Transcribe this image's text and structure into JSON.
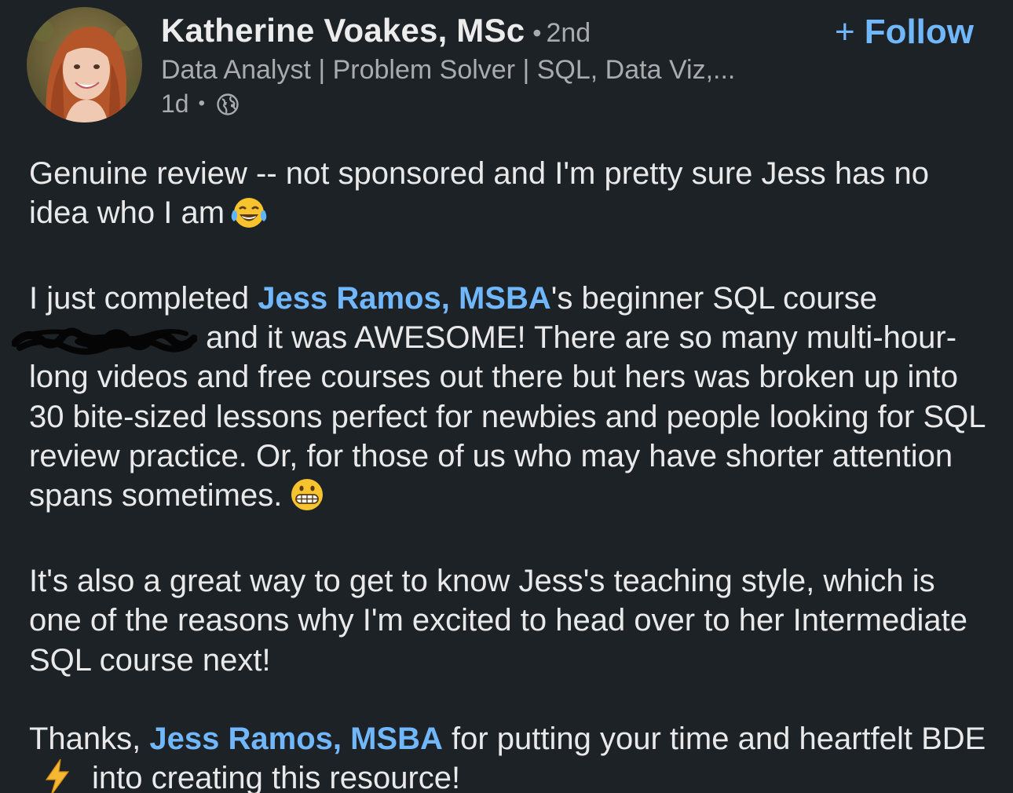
{
  "post": {
    "author": {
      "name": "Katherine Voakes, MSc",
      "degree_separator": "•",
      "degree": "2nd",
      "headline": "Data Analyst | Problem Solver | SQL, Data Viz,...",
      "time": "1d",
      "time_separator": "•",
      "visibility_icon": "globe-icon"
    },
    "follow": {
      "plus": "+",
      "label": "Follow"
    },
    "body": {
      "p1_text": "Genuine review -- not sponsored and I'm pretty sure Jess has no idea who I am",
      "p1_emoji": "tears-of-joy-emoji",
      "p2_before": "I just completed ",
      "p2_mention": "Jess Ramos, MSBA",
      "p2_after_mention": "'s beginner SQL course",
      "p2_redaction": "scribbled-out-text",
      "p2_rest": " and it was AWESOME! There are so many multi-hour-long videos and free courses out there but hers was broken up into 30 bite-sized lessons perfect for newbies and people looking for SQL review practice. Or, for those of us who may have shorter attention spans sometimes.",
      "p2_emoji": "grimacing-emoji",
      "p3_text": "It's also a great way to get to know Jess's teaching style, which is one of the reasons why I'm excited to head over to her Intermediate SQL course next!",
      "p4_before": "Thanks, ",
      "p4_mention": "Jess Ramos, MSBA",
      "p4_after": " for putting your time and heartfelt BDE",
      "p4_emoji": "high-voltage-emoji",
      "p4_end": "into creating this resource!"
    }
  },
  "colors": {
    "background": "#1d2226",
    "text": "#e9e9ea",
    "muted": "#a9abad",
    "accent": "#71b7fb"
  }
}
